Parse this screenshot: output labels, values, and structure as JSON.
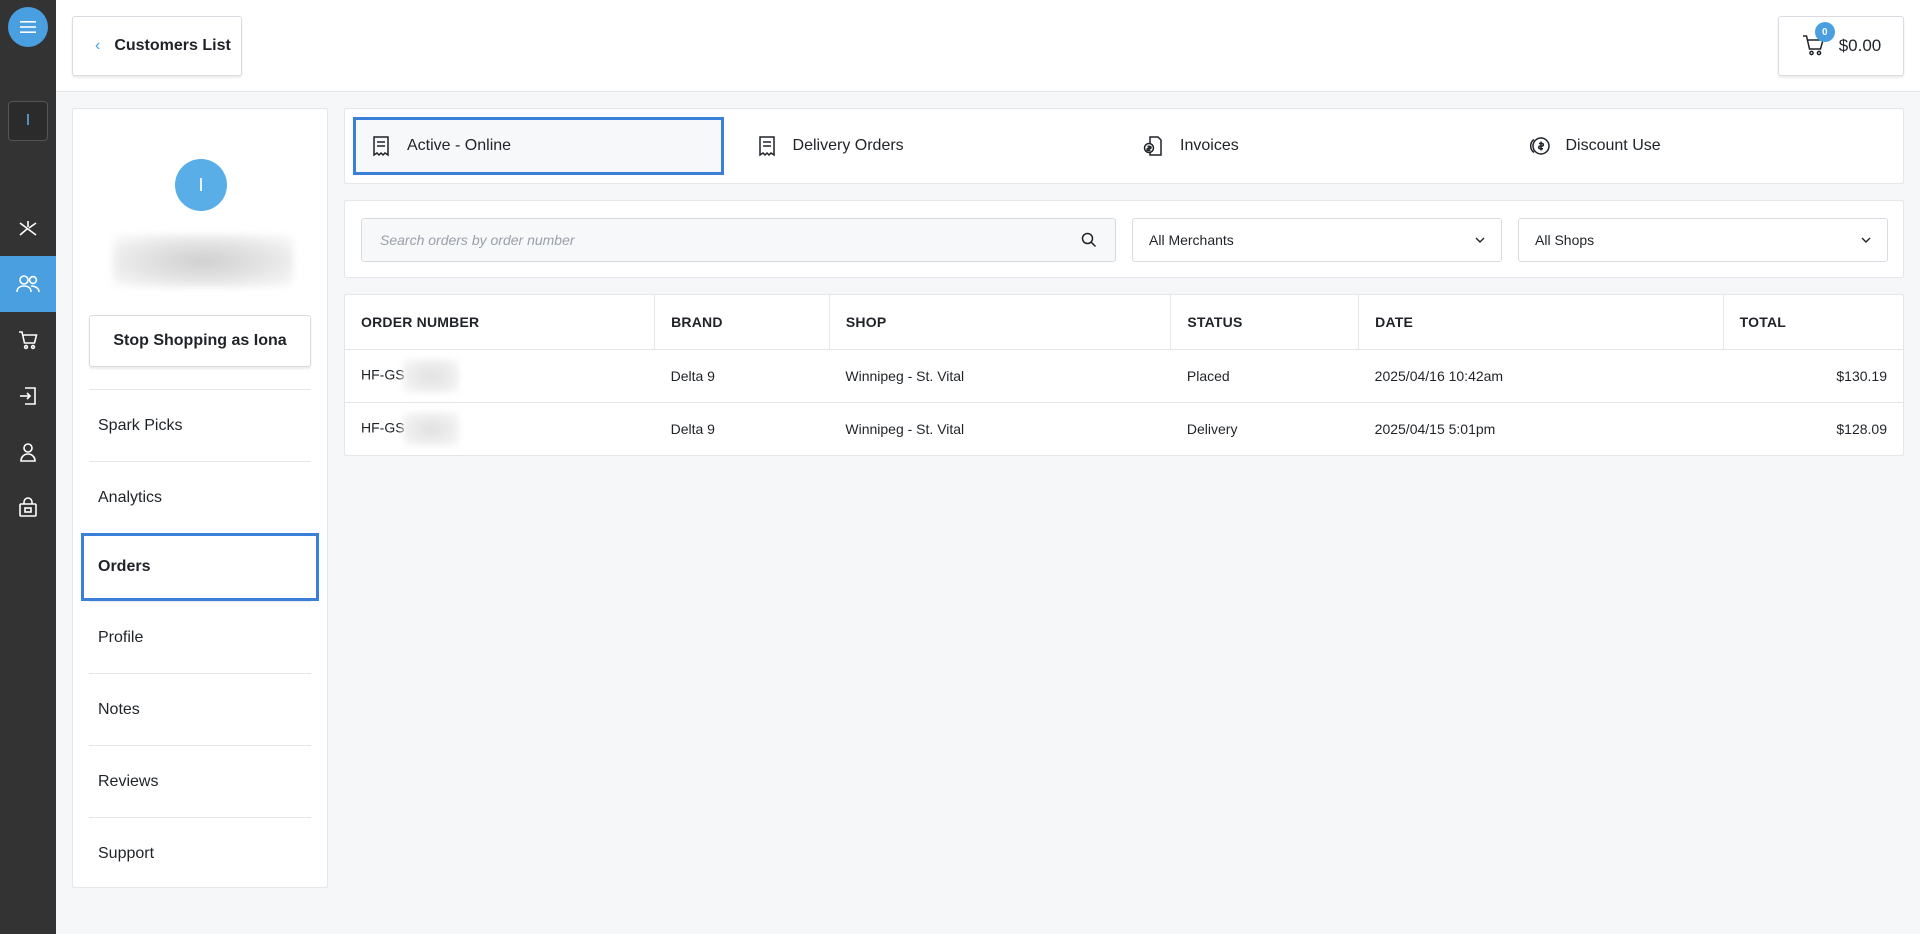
{
  "rail": {
    "store_letter": "I",
    "items": [
      {
        "name": "rail-item-spark",
        "icon": "spark-icon"
      },
      {
        "name": "rail-item-customers",
        "icon": "users-icon",
        "active": true
      },
      {
        "name": "rail-item-cart",
        "icon": "cart-icon"
      },
      {
        "name": "rail-item-orders",
        "icon": "sign-in-icon"
      },
      {
        "name": "rail-item-profile",
        "icon": "user-icon"
      },
      {
        "name": "rail-item-shop",
        "icon": "shopping-bag-icon"
      }
    ]
  },
  "header": {
    "back_label": "Customers List",
    "cart_count": "0",
    "cart_total": "$0.00"
  },
  "customer": {
    "avatar_letter": "I",
    "stop_label": "Stop Shopping as Iona",
    "nav": [
      {
        "label": "Spark Picks"
      },
      {
        "label": "Analytics"
      },
      {
        "label": "Orders",
        "active": true
      },
      {
        "label": "Profile"
      },
      {
        "label": "Notes"
      },
      {
        "label": "Reviews"
      },
      {
        "label": "Support"
      }
    ]
  },
  "tabs": [
    {
      "label": "Active - Online",
      "icon": "receipt-icon",
      "active": true
    },
    {
      "label": "Delivery Orders",
      "icon": "receipt-icon"
    },
    {
      "label": "Invoices",
      "icon": "invoice-icon"
    },
    {
      "label": "Discount Use",
      "icon": "coin-icon"
    }
  ],
  "filters": {
    "search_placeholder": "Search orders by order number",
    "merchants_value": "All Merchants",
    "shops_value": "All Shops"
  },
  "table": {
    "columns": [
      "ORDER NUMBER",
      "BRAND",
      "SHOP",
      "STATUS",
      "DATE",
      "TOTAL"
    ],
    "rows": [
      {
        "order": "HF-GS",
        "brand": "Delta 9",
        "shop": "Winnipeg - St. Vital",
        "status": "Placed",
        "date": "2025/04/16 10:42am",
        "total": "$130.19"
      },
      {
        "order": "HF-GS",
        "brand": "Delta 9",
        "shop": "Winnipeg - St. Vital",
        "status": "Delivery",
        "date": "2025/04/15 5:01pm",
        "total": "$128.09"
      }
    ]
  },
  "colors": {
    "accent": "#4a9fe0",
    "focus_outline": "#3a7fd8",
    "rail_bg": "#333333"
  }
}
